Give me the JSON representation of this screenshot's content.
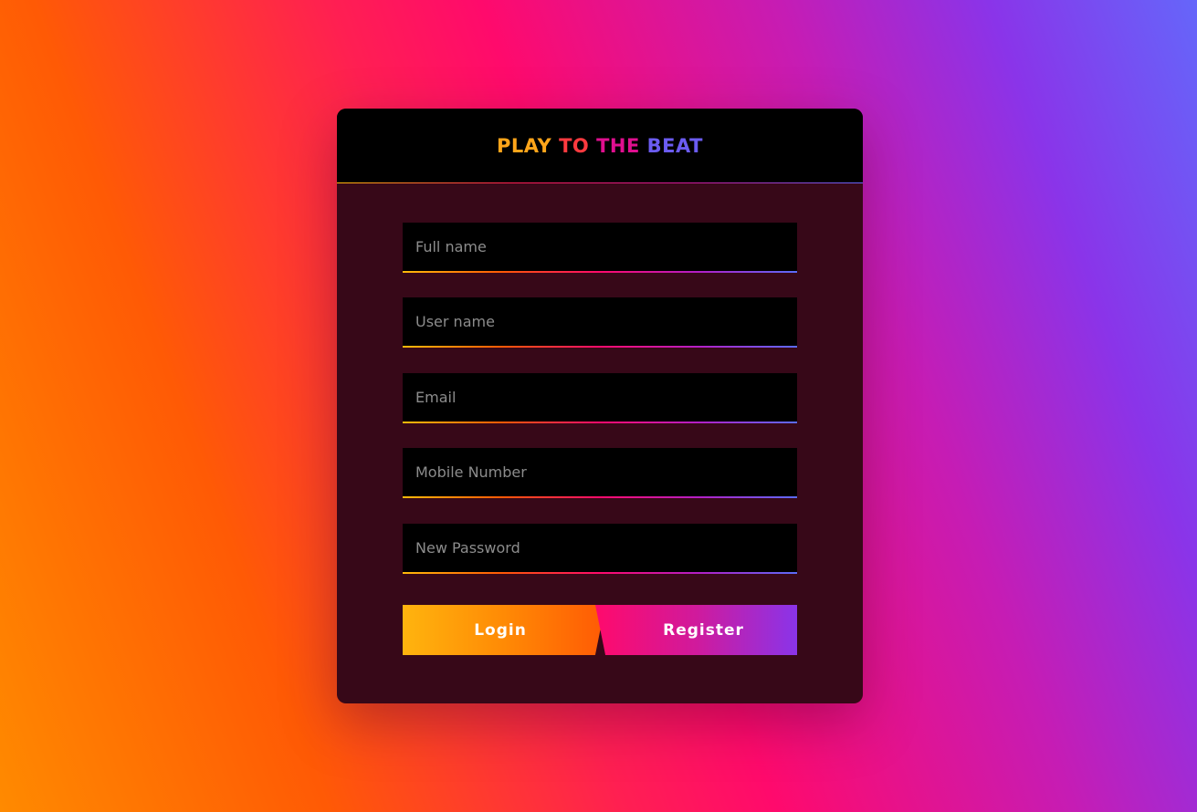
{
  "header": {
    "title_words": [
      {
        "text": "PLAY",
        "color": "#ffa51a"
      },
      {
        "text": "TO",
        "color": "#ff3a3f"
      },
      {
        "text": "THE",
        "color": "#e00f8f"
      },
      {
        "text": "BEAT",
        "color": "#6b5cf2"
      }
    ]
  },
  "form": {
    "fields": [
      {
        "name": "full-name",
        "placeholder": "Full name",
        "value": ""
      },
      {
        "name": "user-name",
        "placeholder": "User name",
        "value": ""
      },
      {
        "name": "email",
        "placeholder": "Email",
        "value": ""
      },
      {
        "name": "mobile-number",
        "placeholder": "Mobile Number",
        "value": ""
      },
      {
        "name": "new-password",
        "placeholder": "New Password",
        "value": ""
      }
    ],
    "buttons": {
      "login_label": "Login",
      "register_label": "Register"
    }
  },
  "colors": {
    "card_background": "#370818",
    "header_background": "#000000",
    "field_background": "#000000",
    "placeholder_text": "#8c8c8c",
    "accent_orange": "#ff5a05",
    "accent_pink": "#ff0a6c",
    "accent_purple": "#8a34e9",
    "accent_blue": "#6566fa"
  }
}
